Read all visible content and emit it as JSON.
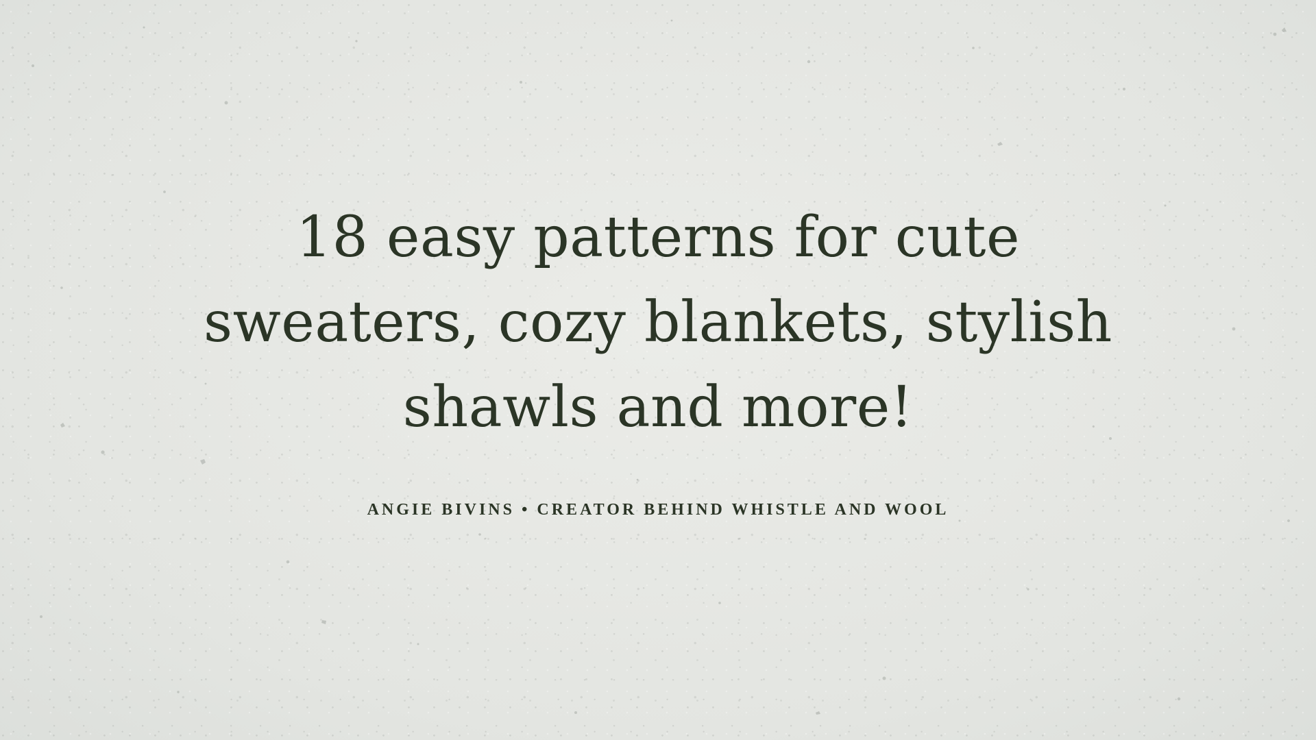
{
  "hero": {
    "headline_lines": [
      "18 easy patterns for cute",
      "sweaters, cozy blankets, stylish",
      "shawls and more!"
    ],
    "byline": {
      "author": "ANGIE BIVINS",
      "separator": "•",
      "role": "CREATOR BEHIND WHISTLE AND WOOL"
    }
  },
  "colors": {
    "text": "#2b3526",
    "background": "#e6e8e4"
  }
}
